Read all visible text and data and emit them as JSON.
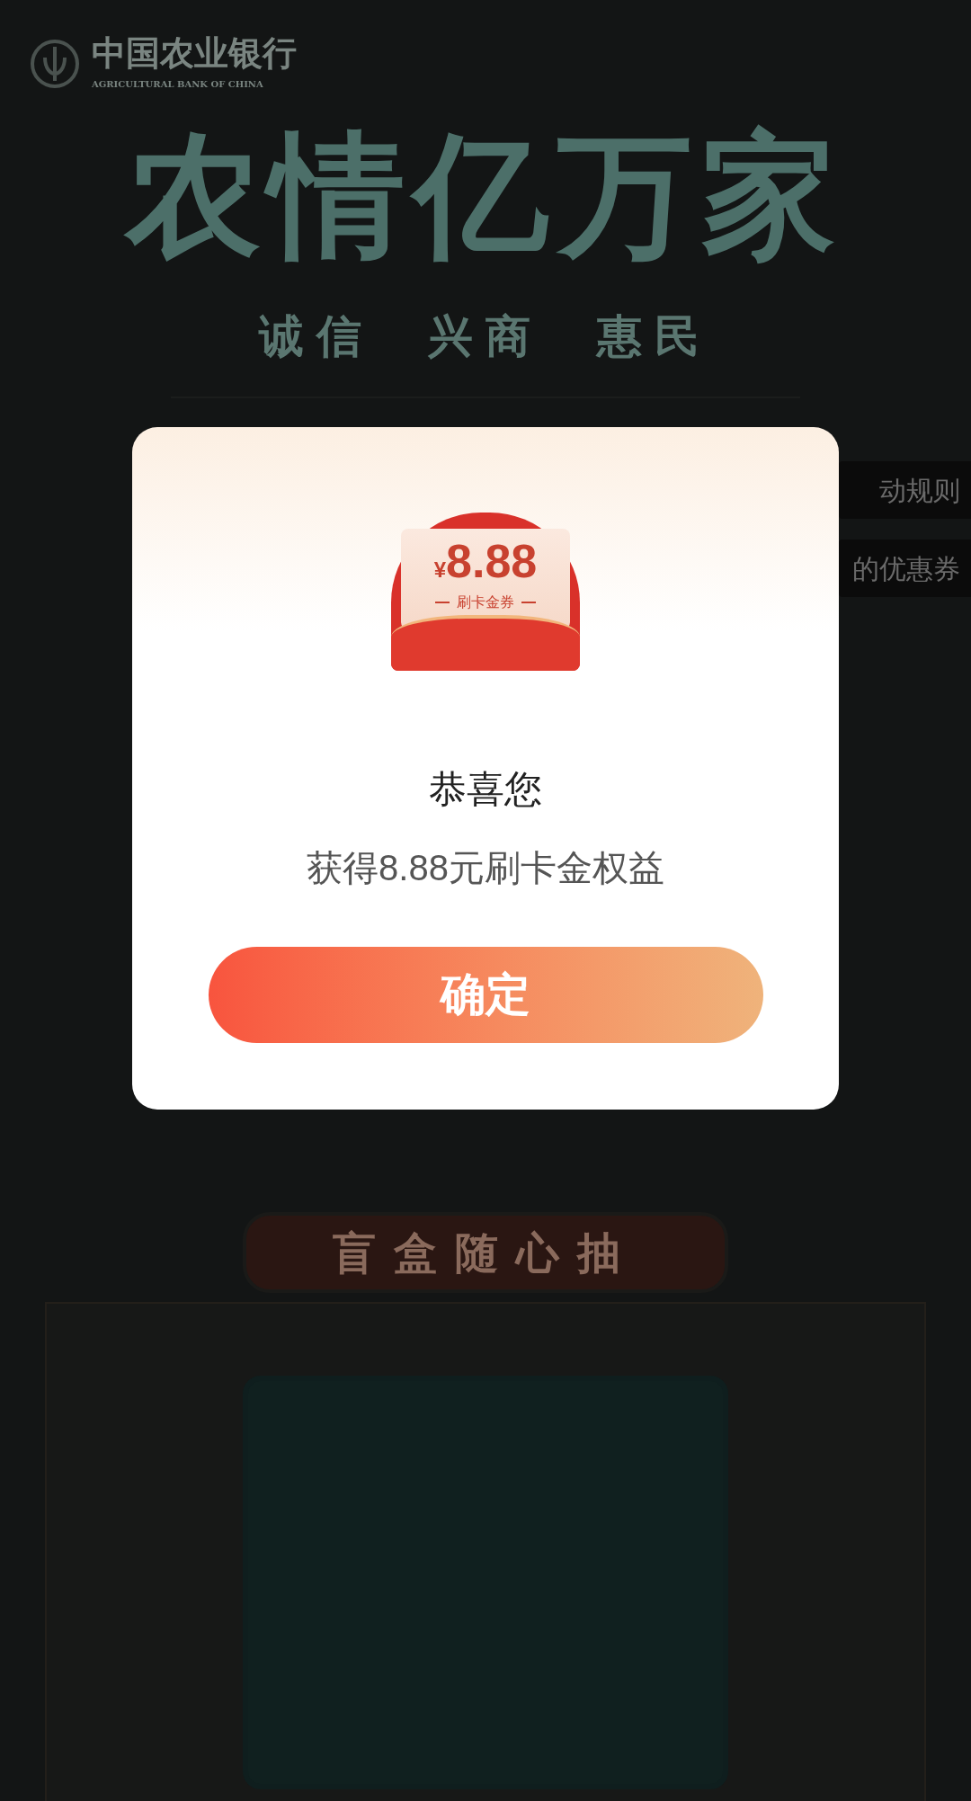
{
  "page": {
    "bank_logo": {
      "name_cn": "中国农业银行",
      "name_en": "AGRICULTURAL BANK OF CHINA"
    },
    "headline": "农情亿万家",
    "slogan": [
      "诚信",
      "兴商",
      "惠民"
    ],
    "side_tabs": [
      "动规则",
      "的优惠券"
    ],
    "section_title": "盲盒随心抽"
  },
  "dialog": {
    "coupon": {
      "currency": "¥",
      "amount": "8.88",
      "label": "刷卡金券"
    },
    "title": "恭喜您",
    "message": "获得8.88元刷卡金权益",
    "confirm_button": "确定"
  }
}
